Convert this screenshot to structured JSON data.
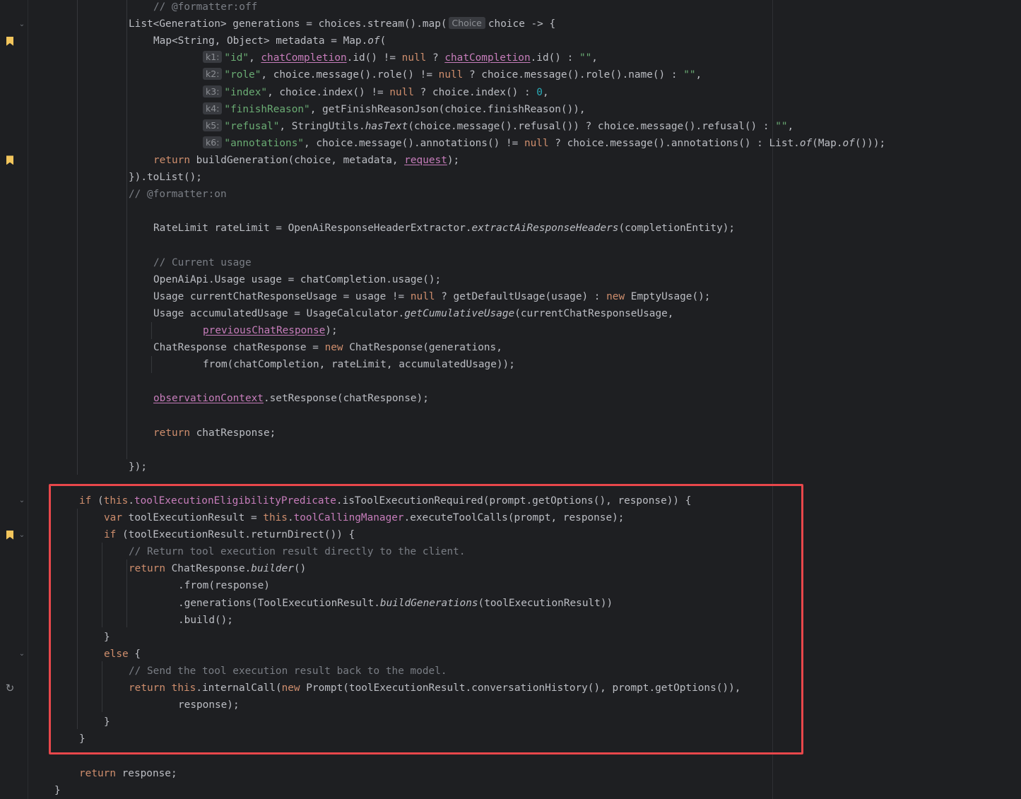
{
  "editor": {
    "highlight_color": "#e8474b",
    "lines": [
      {
        "segs": [
          [
            "cm",
            "// @formatter:off"
          ]
        ]
      },
      {
        "segs": [
          [
            "t",
            "List<Generation> generations = choices.stream().map("
          ],
          [
            "hint",
            "Choice"
          ],
          [
            "t",
            "choice -> {"
          ]
        ]
      },
      {
        "segs": [
          [
            "t",
            "Map<String, Object> metadata = Map."
          ],
          [
            "it",
            "of"
          ],
          [
            "t",
            "("
          ]
        ]
      },
      {
        "segs": [
          [
            "hint",
            "k1:"
          ],
          [
            "str",
            "\"id\""
          ],
          [
            "t",
            ", "
          ],
          [
            "ul",
            "chatCompletion"
          ],
          [
            "t",
            ".id() != "
          ],
          [
            "kw",
            "null"
          ],
          [
            "t",
            " ? "
          ],
          [
            "ul",
            "chatCompletion"
          ],
          [
            "t",
            ".id() : "
          ],
          [
            "str",
            "\"\""
          ],
          [
            "t",
            ","
          ]
        ]
      },
      {
        "segs": [
          [
            "hint",
            "k2:"
          ],
          [
            "str",
            "\"role\""
          ],
          [
            "t",
            ", choice.message().role() != "
          ],
          [
            "kw",
            "null"
          ],
          [
            "t",
            " ? choice.message().role().name() : "
          ],
          [
            "str",
            "\"\""
          ],
          [
            "t",
            ","
          ]
        ]
      },
      {
        "segs": [
          [
            "hint",
            "k3:"
          ],
          [
            "str",
            "\"index\""
          ],
          [
            "t",
            ", choice.index() != "
          ],
          [
            "kw",
            "null"
          ],
          [
            "t",
            " ? choice.index() : "
          ],
          [
            "num",
            "0"
          ],
          [
            "t",
            ","
          ]
        ]
      },
      {
        "segs": [
          [
            "hint",
            "k4:"
          ],
          [
            "str",
            "\"finishReason\""
          ],
          [
            "t",
            ", getFinishReasonJson(choice.finishReason()),"
          ]
        ]
      },
      {
        "segs": [
          [
            "hint",
            "k5:"
          ],
          [
            "str",
            "\"refusal\""
          ],
          [
            "t",
            ", StringUtils."
          ],
          [
            "it",
            "hasText"
          ],
          [
            "t",
            "(choice.message().refusal()) ? choice.message().refusal() : "
          ],
          [
            "str",
            "\"\""
          ],
          [
            "t",
            ","
          ]
        ]
      },
      {
        "segs": [
          [
            "hint",
            "k6:"
          ],
          [
            "str",
            "\"annotations\""
          ],
          [
            "t",
            ", choice.message().annotations() != "
          ],
          [
            "kw",
            "null"
          ],
          [
            "t",
            " ? choice.message().annotations() : List."
          ],
          [
            "it",
            "of"
          ],
          [
            "t",
            "(Map."
          ],
          [
            "it",
            "of"
          ],
          [
            "t",
            "()));"
          ]
        ]
      },
      {
        "segs": [
          [
            "kw",
            "return"
          ],
          [
            "t",
            " buildGeneration(choice, metadata, "
          ],
          [
            "ul",
            "request"
          ],
          [
            "t",
            ");"
          ]
        ]
      },
      {
        "segs": [
          [
            "t",
            "}).toList();"
          ]
        ]
      },
      {
        "segs": [
          [
            "cm",
            "// @formatter:on"
          ]
        ]
      },
      {
        "segs": []
      },
      {
        "segs": [
          [
            "t",
            "RateLimit rateLimit = OpenAiResponseHeaderExtractor."
          ],
          [
            "it",
            "extractAiResponseHeaders"
          ],
          [
            "t",
            "(completionEntity);"
          ]
        ]
      },
      {
        "segs": []
      },
      {
        "segs": [
          [
            "cm",
            "// Current usage"
          ]
        ]
      },
      {
        "segs": [
          [
            "t",
            "OpenAiApi.Usage usage = chatCompletion.usage();"
          ]
        ]
      },
      {
        "segs": [
          [
            "t",
            "Usage currentChatResponseUsage = usage != "
          ],
          [
            "kw",
            "null"
          ],
          [
            "t",
            " ? getDefaultUsage(usage) : "
          ],
          [
            "kw",
            "new"
          ],
          [
            "t",
            " EmptyUsage();"
          ]
        ]
      },
      {
        "segs": [
          [
            "t",
            "Usage accumulatedUsage = UsageCalculator."
          ],
          [
            "it",
            "getCumulativeUsage"
          ],
          [
            "t",
            "(currentChatResponseUsage,"
          ]
        ]
      },
      {
        "segs": [
          [
            "ul",
            "previousChatResponse"
          ],
          [
            "t",
            ");"
          ]
        ]
      },
      {
        "segs": [
          [
            "t",
            "ChatResponse chatResponse = "
          ],
          [
            "kw",
            "new"
          ],
          [
            "t",
            " ChatResponse(generations,"
          ]
        ]
      },
      {
        "segs": [
          [
            "t",
            "from(chatCompletion, rateLimit, accumulatedUsage));"
          ]
        ]
      },
      {
        "segs": []
      },
      {
        "segs": [
          [
            "ul",
            "observationContext"
          ],
          [
            "t",
            ".setResponse(chatResponse);"
          ]
        ]
      },
      {
        "segs": []
      },
      {
        "segs": [
          [
            "kw",
            "return"
          ],
          [
            "t",
            " chatResponse;"
          ]
        ]
      },
      {
        "segs": []
      },
      {
        "segs": [
          [
            "t",
            "});"
          ]
        ]
      },
      {
        "segs": []
      },
      {
        "segs": [
          [
            "kw",
            "if"
          ],
          [
            "t",
            " ("
          ],
          [
            "kw",
            "this"
          ],
          [
            "t",
            "."
          ],
          [
            "fld",
            "toolExecutionEligibilityPredicate"
          ],
          [
            "t",
            ".isToolExecutionRequired(prompt.getOptions(), response)) {"
          ]
        ]
      },
      {
        "segs": [
          [
            "kw",
            "var"
          ],
          [
            "t",
            " toolExecutionResult = "
          ],
          [
            "kw",
            "this"
          ],
          [
            "t",
            "."
          ],
          [
            "fld",
            "toolCallingManager"
          ],
          [
            "t",
            ".executeToolCalls(prompt, response);"
          ]
        ]
      },
      {
        "segs": [
          [
            "kw",
            "if"
          ],
          [
            "t",
            " (toolExecutionResult.returnDirect()) {"
          ]
        ]
      },
      {
        "segs": [
          [
            "cm",
            "// Return tool execution result directly to the client."
          ]
        ]
      },
      {
        "segs": [
          [
            "kw",
            "return"
          ],
          [
            "t",
            " ChatResponse."
          ],
          [
            "it",
            "builder"
          ],
          [
            "t",
            "()"
          ]
        ]
      },
      {
        "segs": [
          [
            "t",
            ".from(response)"
          ]
        ]
      },
      {
        "segs": [
          [
            "t",
            ".generations(ToolExecutionResult."
          ],
          [
            "it",
            "buildGenerations"
          ],
          [
            "t",
            "(toolExecutionResult))"
          ]
        ]
      },
      {
        "segs": [
          [
            "t",
            ".build();"
          ]
        ]
      },
      {
        "segs": [
          [
            "t",
            "}"
          ]
        ]
      },
      {
        "segs": [
          [
            "kw",
            "else"
          ],
          [
            "t",
            " {"
          ]
        ]
      },
      {
        "segs": [
          [
            "cm",
            "// Send the tool execution result back to the model."
          ]
        ]
      },
      {
        "segs": [
          [
            "kw",
            "return"
          ],
          [
            "t",
            " "
          ],
          [
            "kw",
            "this"
          ],
          [
            "t",
            ".internalCall("
          ],
          [
            "kw",
            "new"
          ],
          [
            "t",
            " Prompt(toolExecutionResult.conversationHistory(), prompt.getOptions()),"
          ]
        ]
      },
      {
        "segs": [
          [
            "t",
            "response);"
          ]
        ]
      },
      {
        "segs": [
          [
            "t",
            "}"
          ]
        ]
      },
      {
        "segs": [
          [
            "t",
            "}"
          ]
        ]
      },
      {
        "segs": []
      },
      {
        "segs": [
          [
            "kw",
            "return"
          ],
          [
            "t",
            " response;"
          ]
        ]
      },
      {
        "segs": [
          [
            "t",
            "}"
          ]
        ]
      }
    ],
    "gutter_icons": [
      {
        "line": 1,
        "icon": "fold-chevron-icon",
        "glyph": "⌄"
      },
      {
        "line": 2,
        "icon": "bookmark-icon"
      },
      {
        "line": 9,
        "icon": "bookmark-icon"
      },
      {
        "line": 29,
        "icon": "fold-chevron-icon",
        "glyph": "⌄"
      },
      {
        "line": 31,
        "icon": "bookmark-icon"
      },
      {
        "line": 31,
        "icon": "fold-chevron-icon",
        "glyph": "⌄"
      },
      {
        "line": 38,
        "icon": "fold-chevron-icon",
        "glyph": "⌄"
      },
      {
        "line": 40,
        "icon": "recursive-call-icon",
        "glyph": "↻"
      }
    ]
  }
}
